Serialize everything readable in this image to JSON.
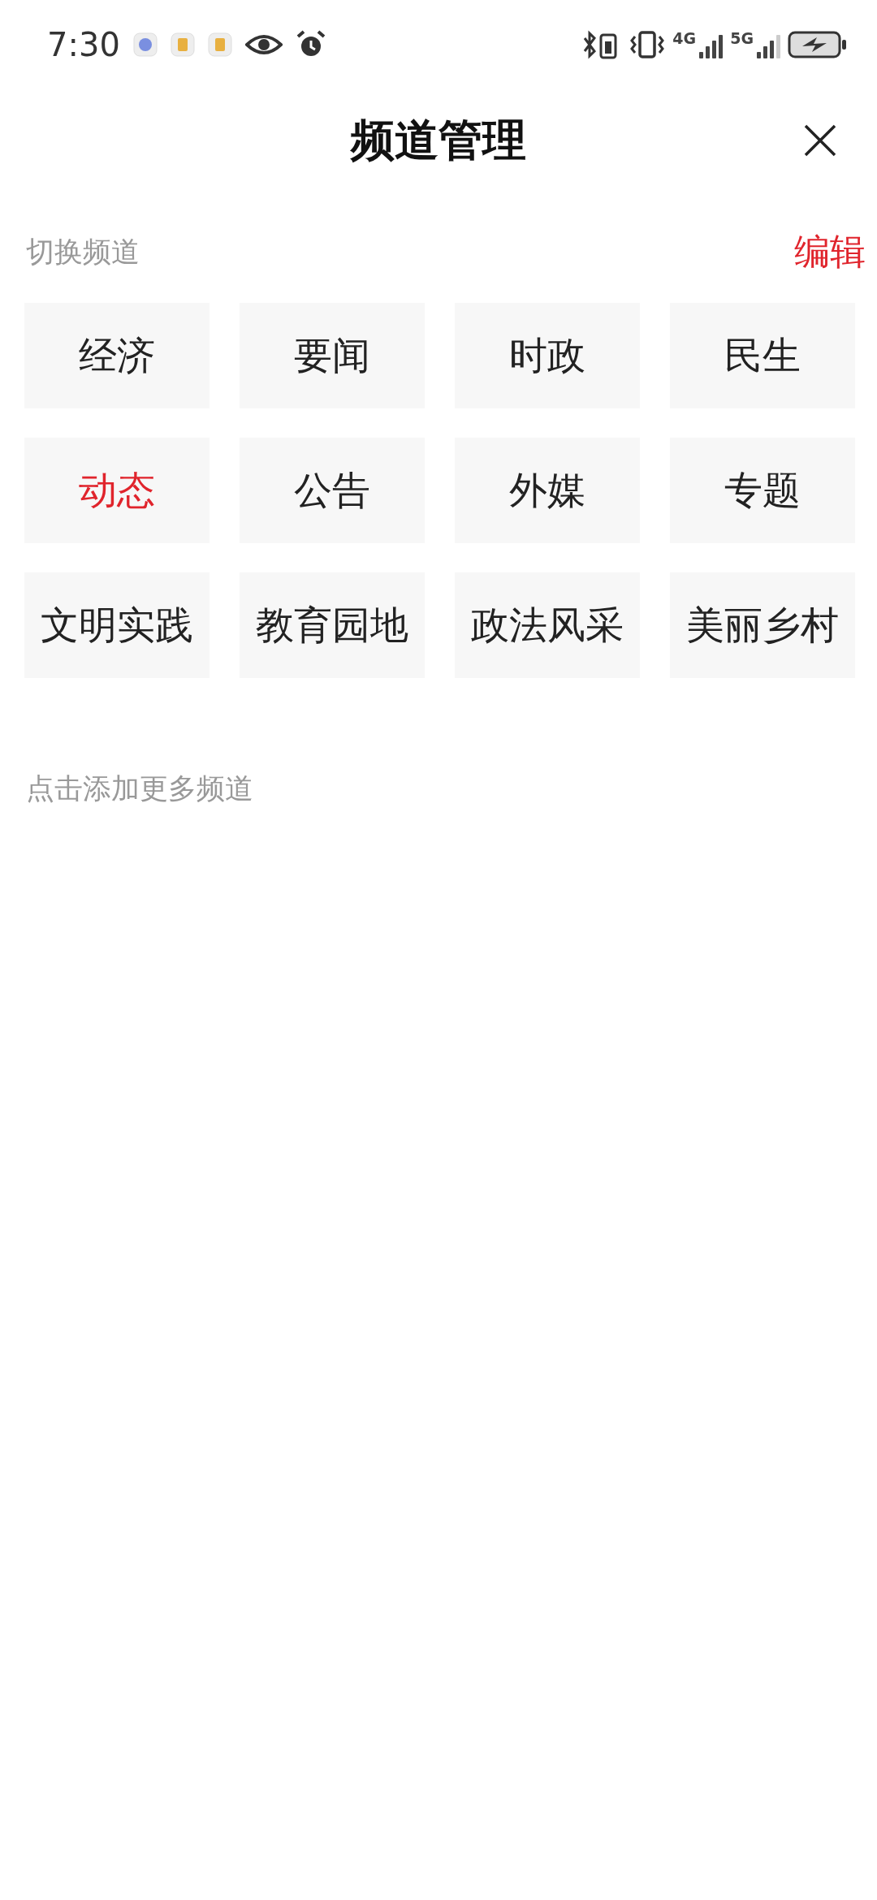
{
  "status_bar": {
    "time": "7:30",
    "signals": [
      {
        "label": "4G"
      },
      {
        "label": "5G"
      }
    ]
  },
  "header": {
    "title": "频道管理"
  },
  "switch_section": {
    "label": "切换频道",
    "edit_link": "编辑"
  },
  "channels": [
    {
      "label": "经济",
      "selected": false
    },
    {
      "label": "要闻",
      "selected": false
    },
    {
      "label": "时政",
      "selected": false
    },
    {
      "label": "民生",
      "selected": false
    },
    {
      "label": "动态",
      "selected": true
    },
    {
      "label": "公告",
      "selected": false
    },
    {
      "label": "外媒",
      "selected": false
    },
    {
      "label": "专题",
      "selected": false
    },
    {
      "label": "文明实践",
      "selected": false
    },
    {
      "label": "教育园地",
      "selected": false
    },
    {
      "label": "政法风采",
      "selected": false
    },
    {
      "label": "美丽乡村",
      "selected": false
    }
  ],
  "add_section": {
    "label": "点击添加更多频道"
  }
}
